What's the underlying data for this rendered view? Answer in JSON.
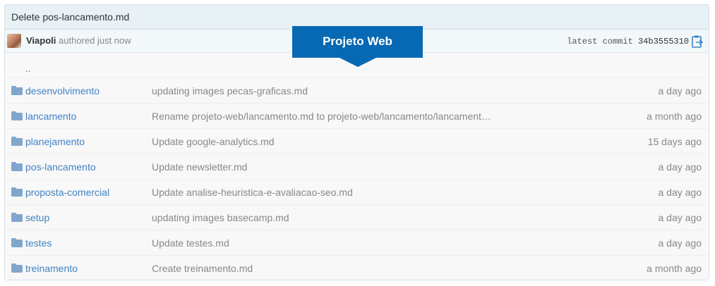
{
  "commit": {
    "message": "Delete pos-lancamento.md",
    "author": "Viapoli",
    "authored_text": "authored just now",
    "latest_label": "latest commit",
    "sha": "34b3555310"
  },
  "banner": {
    "title": "Projeto Web",
    "color": "#0769b4"
  },
  "up_link": "..",
  "files": [
    {
      "name": "desenvolvimento",
      "message": "updating images pecas-graficas.md",
      "age": "a day ago"
    },
    {
      "name": "lancamento",
      "message": "Rename projeto-web/lancamento.md to projeto-web/lancamento/lancament…",
      "age": "a month ago"
    },
    {
      "name": "planejamento",
      "message": "Update google-analytics.md",
      "age": "15 days ago"
    },
    {
      "name": "pos-lancamento",
      "message": "Update newsletter.md",
      "age": "a day ago"
    },
    {
      "name": "proposta-comercial",
      "message": "Update analise-heuristica-e-avaliacao-seo.md",
      "age": "a day ago"
    },
    {
      "name": "setup",
      "message": "updating images basecamp.md",
      "age": "a day ago"
    },
    {
      "name": "testes",
      "message": "Update testes.md",
      "age": "a day ago"
    },
    {
      "name": "treinamento",
      "message": "Create treinamento.md",
      "age": "a month ago"
    }
  ],
  "icons": {
    "folder": "folder-icon",
    "clipboard": "clipboard-icon",
    "avatar": "avatar"
  },
  "colors": {
    "link": "#4183c4",
    "header_bg": "#e8f1f6"
  }
}
